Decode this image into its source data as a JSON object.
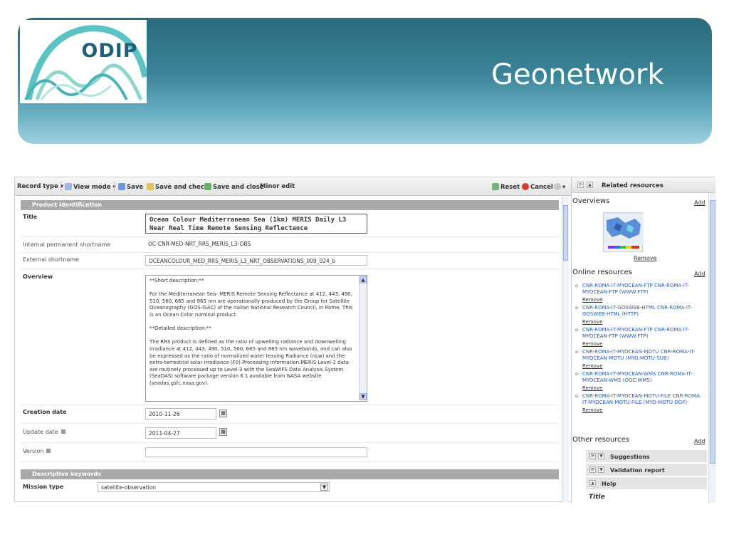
{
  "slide": {
    "logo_text": "ODIP",
    "title": "Geonetwork"
  },
  "toolbar": {
    "record_type": "Record type",
    "view_mode": "View mode",
    "save": "Save",
    "save_and_check": "Save and check",
    "save_and_close": "Save and close",
    "minor_edit": "Minor edit",
    "reset": "Reset",
    "cancel": "Cancel"
  },
  "form": {
    "section_product": "Product identification",
    "title_label": "Title",
    "title_value": "Ocean Colour Mediterranean Sea (1km) MERIS Daily L3 Near Real Time Remote Sensing Reflectance",
    "internal_label": "Internal permanent shortname",
    "internal_value": "OC-CNR-MED-NRT_RRS_MERIS_L3-OBS",
    "external_label": "External shortname",
    "external_value": "OCEANCOLOUR_MED_RRS_MERIS_L3_NRT_OBSERVATIONS_009_024_b",
    "overview_label": "Overview",
    "overview_paragraphs": [
      "**Short description:**",
      "For the Mediterranean Sea- MERIS Remote Sensing Reflectance at 412, 443, 490, 510, 560, 665 and 865 nm are operationally produced by the Group for Satellite Oceanography (GOS-ISAC) of the Italian National Research Council, in Rome. This is an Ocean Color nominal product.",
      "**Detailed description:**",
      "The RRS product is defined as the ratio of upwelling radiance and downwelling irradiance at 412, 443, 490, 510, 560, 665 and 865 nm wavebands, and can also be expressed as the ratio of normalized water leaving Radiance (nLw) and the extra-terrestrial solar irradiance (F0).Processing information:MERIS Level-2 data are routinely processed up to Level-3 with the SeaWIFS Data Analysis System (SeaDAS) software package version 6.1 available from NASA website (seadas.gsfc.nasa.gov)."
    ],
    "creation_label": "Creation date",
    "creation_value": "2010-11-26",
    "update_label": "Update date",
    "update_value": "2011-04-27",
    "version_label": "Version",
    "version_value": "",
    "section_keywords": "Descriptive keywords",
    "mission_label": "Mission type",
    "mission_value": "satellite-observation"
  },
  "right_panel": {
    "header": "Related resources",
    "overviews": "Overviews",
    "online_resources": "Online resources",
    "other_resources": "Other resources",
    "add": "Add",
    "remove": "Remove",
    "online_items": [
      "CNR-ROMA-IT-MYOCEAN-FTP CNR-ROMA-IT-MYOCEAN-FTP (WWW:FTP)",
      "CNR-ROMA-IT-GOSWEB-HTML CNR-ROMA-IT-GOSWEB-HTML (HTTP)",
      "CNR-ROMA-IT-MYOCEAN-FTP CNR-ROMA-IT-MYOCEAN-FTP (WWW:FTP)",
      "CNR-ROMA-IT-MYOCEAN-MOTU CNR-ROMA-IT-MYOCEAN-MOTU (MYO:MOTU-SUB)",
      "CNR-ROMA-IT-MYOCEAN-WMS CNR-ROMA-IT-MYOCEAN-WMS (OGC:WMS)",
      "CNR-ROMA-IT-MYOCEAN-MOTU-FILE CNR-ROMA-IT-MYOCEAN-MOTU-FILE (MYO:MOTU-DGF)"
    ],
    "suggestions": "Suggestions",
    "validation_report": "Validation report",
    "help": "Help",
    "help_title": "Title"
  }
}
